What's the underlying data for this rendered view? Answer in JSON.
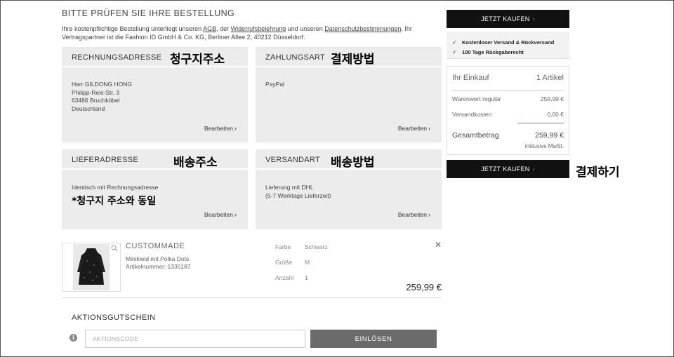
{
  "page": {
    "title": "BITTE PRÜFEN SIE IHRE BESTELLUNG",
    "notice": {
      "part1": "Ihre kostenpflichtige Bestellung unterliegt unseren ",
      "agb": "AGB",
      "part2": ", der ",
      "widerruf": "Widerrufsbelehrung",
      "part3": " und unseren ",
      "datenschutz": "Datenschutzbestimmungen",
      "part4": ". Ihr Vertragspartner ist die Fashion ID GmbH & Co. KG, Berliner Allee 2, 40212 Düsseldorf."
    }
  },
  "billing": {
    "title": "RECHNUNGSADRESSE",
    "annotation": "청구지주소",
    "lines": [
      "Herr GILDONG HONG",
      "Philipp-Reis-Str. 3",
      "63486 Bruchköbel",
      "Deutschland"
    ],
    "edit": "Bearbeiten"
  },
  "payment": {
    "title": "ZAHLUNGSART",
    "annotation": "결제방법",
    "lines": [
      "PayPal"
    ],
    "edit": "Bearbeiten"
  },
  "delivery": {
    "title": "LIEFERADRESSE",
    "annotation": "배송주소",
    "lines": [
      "Identisch mit Rechnungsadresse"
    ],
    "note": "*청구지 주소와 동일",
    "edit": "Bearbeiten"
  },
  "shipping": {
    "title": "VERSANDART",
    "annotation": "배송방법",
    "lines": [
      "Lieferung mit DHL",
      "(5-7 Werktage Lieferzeit)"
    ],
    "edit": "Bearbeiten"
  },
  "product": {
    "brand": "CUSTOMMADE",
    "name": "Minikleid mit Polka Dots",
    "article": "Artikelnummer: 1335187",
    "attributes": [
      {
        "label": "Farbe",
        "value": "Schwarz"
      },
      {
        "label": "Größe",
        "value": "M"
      },
      {
        "label": "Anzahl",
        "value": "1"
      }
    ],
    "price": "259,99 €",
    "zoom_icon": "magnifier-icon",
    "remove_icon": "close-icon"
  },
  "voucher": {
    "title": "AKTIONSGUTSCHEIN",
    "placeholder": "AKTIONSCODE",
    "button": "EINLÖSEN",
    "info_icon": "info-icon"
  },
  "sidebar": {
    "buy_label": "JETZT KAUFEN",
    "benefits": [
      "Kostenloser Versand & Rückversand",
      "100 Tage Rückgaberecht"
    ],
    "summary": {
      "head_label": "Ihr Einkauf",
      "head_value": "1 Artikel",
      "rows": [
        {
          "label": "Warenwert regulär",
          "value": "259,99 €"
        },
        {
          "label": "Versandkosten",
          "value": "0,00 €"
        }
      ],
      "total_label": "Gesamtbetrag",
      "total_value": "259,99 €",
      "vat": "inklusive MwSt."
    },
    "pay_annotation": "결제하기"
  }
}
